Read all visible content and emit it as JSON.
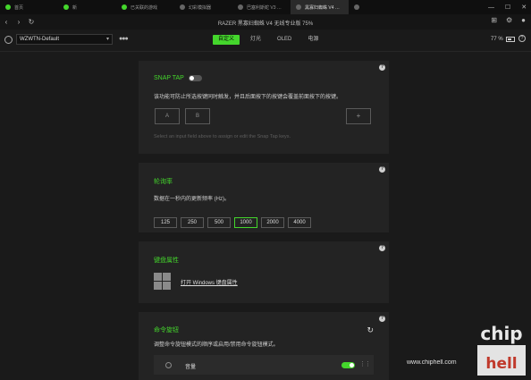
{
  "tabs": [
    {
      "label": "首页",
      "active": false
    },
    {
      "label": "新",
      "active": false
    },
    {
      "label": "已关联的游戏",
      "active": false
    },
    {
      "label": "幻彩模拟器",
      "active": false
    },
    {
      "label": "巴塞利斯蛇 V3 专业版",
      "active": false
    },
    {
      "label": "黑寡妇蜘蛛 V4 无线专业版",
      "active": true
    },
    {
      "label": "",
      "active": false
    }
  ],
  "window": {
    "title": "RAZER 黑寡妇蜘蛛 V4 无线专业版 75%"
  },
  "toolbar": {
    "profile": "WZWTN-Default",
    "pages": [
      "自定义",
      "灯光",
      "OLED",
      "电源"
    ],
    "active_page": 0,
    "battery": "77 %"
  },
  "snap_tap": {
    "title": "SNAP TAP",
    "enabled": false,
    "description": "该功能可防止所选按键同时触发，并且后面按下的按键会覆盖前面按下的按键。",
    "key_a": "A",
    "key_b": "B",
    "add_label": "+",
    "hint": "Select an input field above to assign or edit the Snap Tap keys."
  },
  "polling": {
    "title": "轮询率",
    "description": "数据在一秒内的更新频率 (Hz)。",
    "rates": [
      "125",
      "250",
      "500",
      "1000",
      "2000",
      "4000"
    ],
    "selected": "1000"
  },
  "keyboard": {
    "title": "键盘属性",
    "link": "打开 Windows 键盘属性"
  },
  "macro": {
    "title": "命令旋钮",
    "description": "调整命令旋钮模式的顺序或启用/禁用命令旋钮模式。",
    "row_label": "音量",
    "row_enabled": true
  },
  "watermark": {
    "site": "www.chiphell.com",
    "logo": "chip hell"
  },
  "colors": {
    "accent": "#44d62c",
    "panel": "#232323",
    "background": "#1a1a1a"
  }
}
